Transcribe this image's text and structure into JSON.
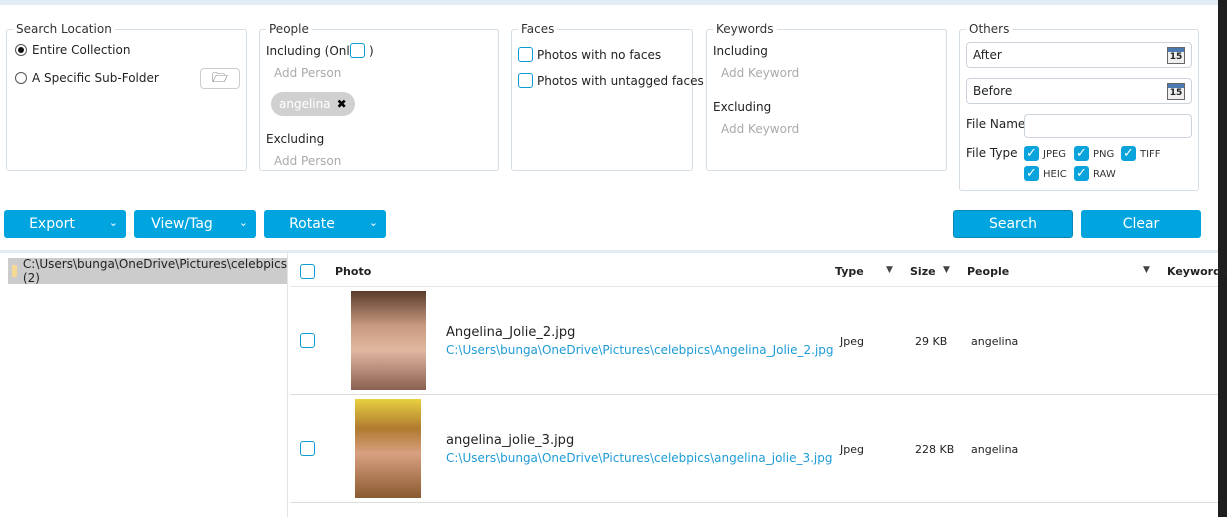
{
  "search_location": {
    "title": "Search Location",
    "options": [
      "Entire Collection",
      "A Specific Sub-Folder"
    ],
    "selected": 0
  },
  "people": {
    "title": "People",
    "including": "Including (Only",
    "close_paren": ")",
    "add_person": "Add Person",
    "chips": [
      "angelina"
    ],
    "excluding": "Excluding",
    "add_person2": "Add Person"
  },
  "faces": {
    "title": "Faces",
    "no_faces": "Photos with no faces",
    "untagged": "Photos with untagged faces"
  },
  "keywords": {
    "title": "Keywords",
    "including": "Including",
    "add_keyword": "Add Keyword",
    "excluding": "Excluding",
    "add_keyword2": "Add Keyword"
  },
  "others": {
    "title": "Others",
    "after": "After",
    "before": "Before",
    "cal_day": "15",
    "file_name": "File Name",
    "file_name_value": "",
    "file_type": "File Type",
    "types": [
      "JPEG",
      "PNG",
      "TIFF",
      "HEIC",
      "RAW"
    ]
  },
  "toolbar": {
    "export": "Export",
    "view_tag": "View/Tag",
    "rotate": "Rotate",
    "search": "Search",
    "clear": "Clear",
    "chevron": "⌄"
  },
  "tree": {
    "folder": "C:\\Users\\bunga\\OneDrive\\Pictures\\celebpics (2)"
  },
  "table": {
    "headers": {
      "photo": "Photo",
      "type": "Type",
      "size": "Size",
      "people": "People",
      "keywords": "Keywords"
    },
    "rows": [
      {
        "name": "Angelina_Jolie_2.jpg",
        "path": "C:\\Users\\bunga\\OneDrive\\Pictures\\celebpics\\Angelina_Jolie_2.jpg",
        "type": "Jpeg",
        "size": "29 KB",
        "people": "angelina"
      },
      {
        "name": "angelina_jolie_3.jpg",
        "path": "C:\\Users\\bunga\\OneDrive\\Pictures\\celebpics\\angelina_jolie_3.jpg",
        "type": "Jpeg",
        "size": "228 KB",
        "people": "angelina"
      }
    ]
  },
  "colors": {
    "accent": "#00a5e0"
  }
}
